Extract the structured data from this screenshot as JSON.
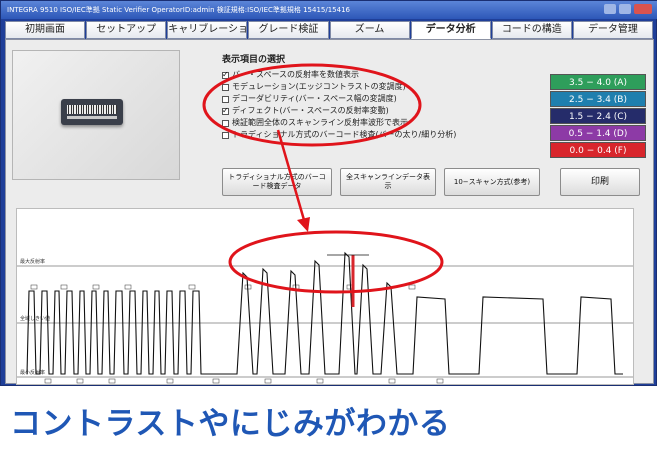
{
  "window": {
    "title": "INTEGRA 9510 ISO/IEC準拠 Static Verifier   OperatorID:admin   検証規格:ISO/IEC準拠規格 15415/15416"
  },
  "tabs": [
    {
      "label": "初期画面"
    },
    {
      "label": "セットアップ"
    },
    {
      "label": "キャリブレーション"
    },
    {
      "label": "グレード検証"
    },
    {
      "label": "ズーム"
    },
    {
      "label": "データ分析",
      "active": true
    },
    {
      "label": "コードの構造"
    },
    {
      "label": "データ管理"
    }
  ],
  "display_options": {
    "title": "表示項目の選択",
    "items": [
      {
        "label": "バー・スペースの反射率を数値表示",
        "checked": true
      },
      {
        "label": "モデュレーション(エッジコントラストの変調度)",
        "checked": false
      },
      {
        "label": "デコーダビリティ(バー・スペース幅の変調度)",
        "checked": false
      },
      {
        "label": "ディフェクト(バー・スペースの反射率変動)",
        "checked": true
      },
      {
        "label": "検証範囲全体のスキャンライン反射率波形で表示",
        "checked": false
      },
      {
        "label": "トラディショナル方式のバーコード検査(バーの太り/細り分析)",
        "checked": false
      }
    ]
  },
  "grades": [
    {
      "label": "3.5 − 4.0 (A)",
      "color": "#2e9e5b"
    },
    {
      "label": "2.5 − 3.4 (B)",
      "color": "#1f7fae"
    },
    {
      "label": "1.5 − 2.4 (C)",
      "color": "#252c6a"
    },
    {
      "label": "0.5 − 1.4 (D)",
      "color": "#8d3aa6"
    },
    {
      "label": "0.0 − 0.4 (F)",
      "color": "#d8262c"
    }
  ],
  "buttons": {
    "traditional": "トラディショナル方式のバーコード検査データ",
    "all_scans": "全スキャンラインデータ表示",
    "ten_scans": "10−スキャン方式(参考)",
    "print": "印刷"
  },
  "graph": {
    "labels": {
      "max": "最大反射率",
      "threshold": "全域しきい値",
      "min": "最小反射率"
    }
  },
  "caption": "コントラストやにじみがわかる",
  "annotation_color": "#e0141b"
}
